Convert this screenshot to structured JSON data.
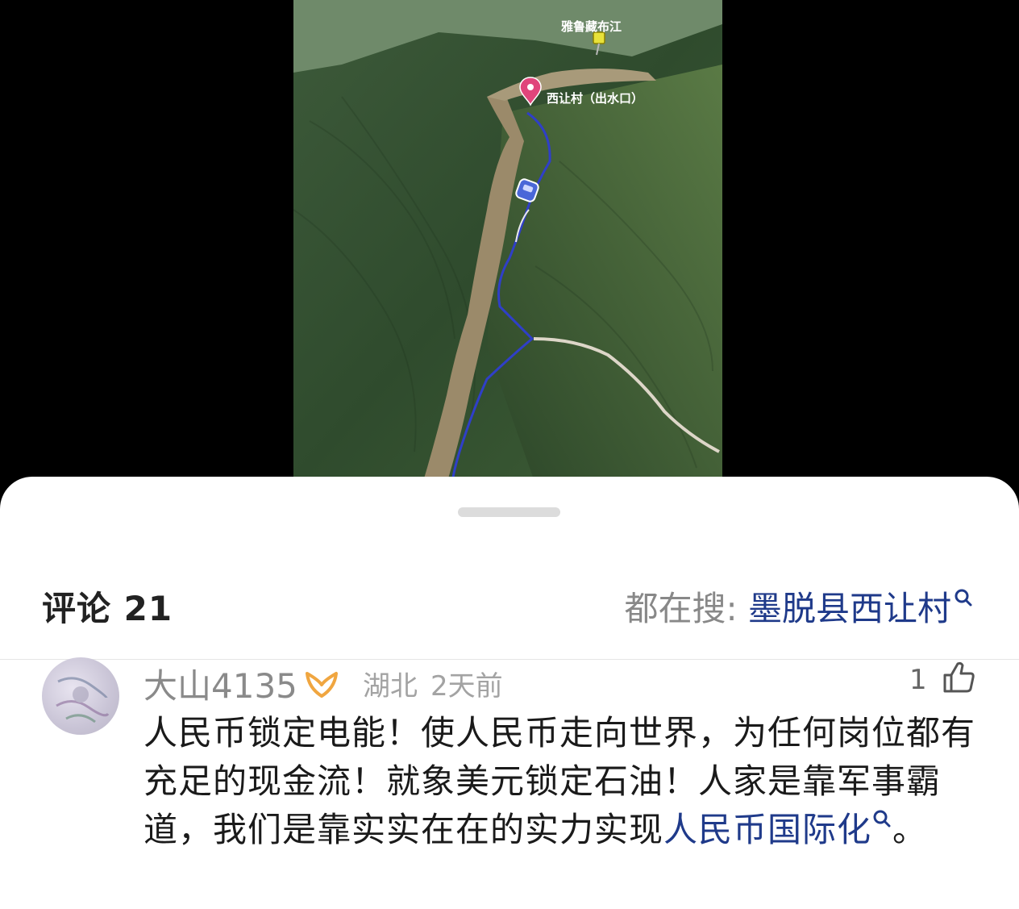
{
  "video": {
    "map_labels": {
      "river": "雅鲁藏布江",
      "village": "西让村（出水口）"
    }
  },
  "comments": {
    "title": "评论 21",
    "trending_label": "都在搜: ",
    "trending_term": "墨脱县西让村"
  },
  "comment": {
    "username": "大山4135",
    "location": "湖北",
    "time": "2天前",
    "likes": "1",
    "text_part1": "人民币锁定电能！使人民币走向世界，为任何岗位都有充足的现金流！就象美元锁定石油！人家是靠军事霸道，我们是靠实实在在的实力实现",
    "keyword": "人民币国际化",
    "text_part2": "。"
  },
  "colors": {
    "link": "#1f3a8a",
    "muted": "#888888",
    "badge": "#f0a640"
  },
  "icons": {
    "search": "search-icon",
    "like": "thumb-up-icon",
    "vip": "vip-badge-icon",
    "pin": "map-pin-icon",
    "pushpin": "pushpin-icon",
    "car": "car-icon"
  }
}
